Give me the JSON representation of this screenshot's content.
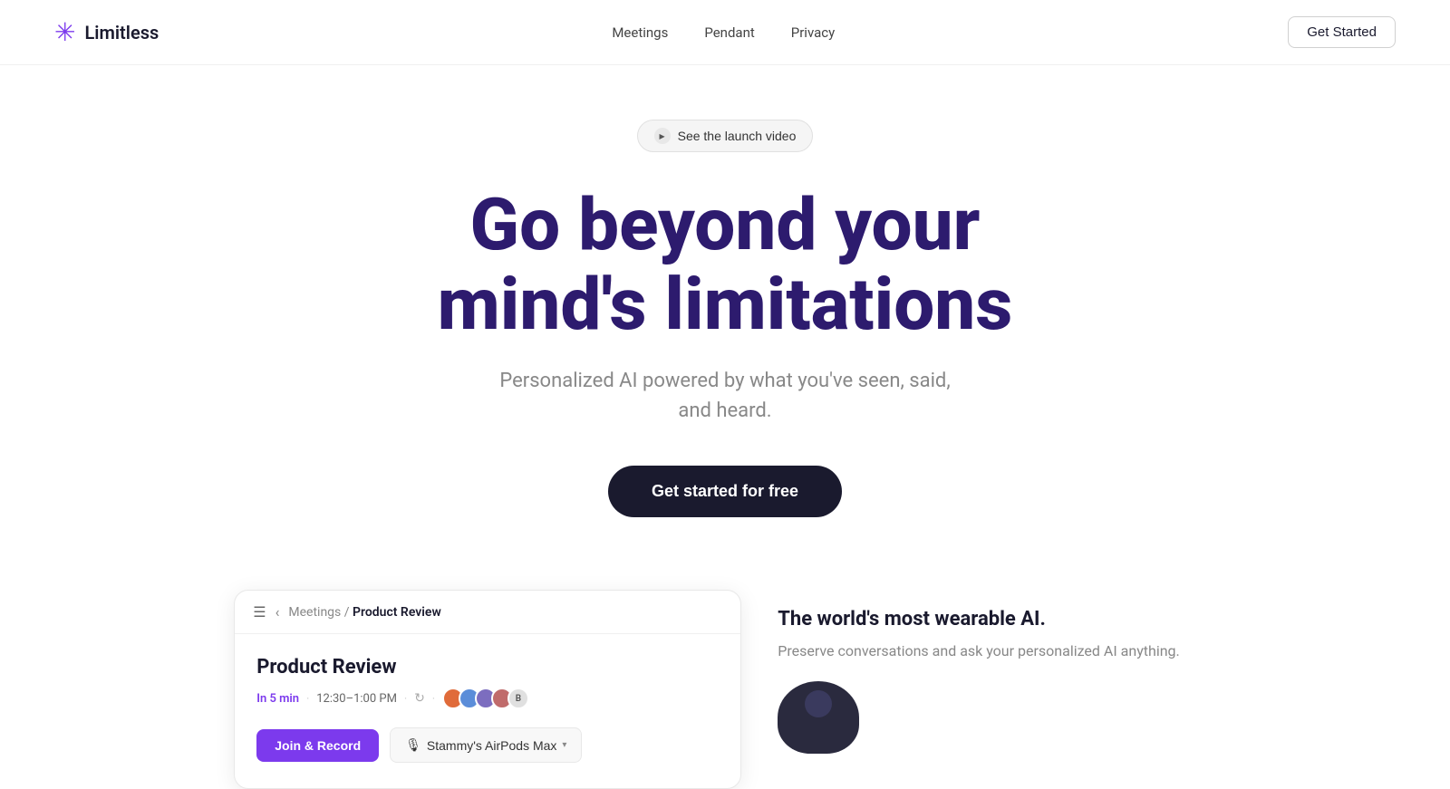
{
  "nav": {
    "logo_text": "Limitless",
    "links": [
      {
        "label": "Meetings",
        "id": "meetings"
      },
      {
        "label": "Pendant",
        "id": "pendant"
      },
      {
        "label": "Privacy",
        "id": "privacy"
      }
    ],
    "cta_label": "Get Started"
  },
  "hero": {
    "launch_video_label": "See the launch video",
    "title_line1": "Go beyond your",
    "title_line2": "mind's limitations",
    "subtitle": "Personalized AI powered by what you've seen, said, and heard.",
    "cta_label": "Get started for free"
  },
  "app_preview": {
    "topbar": {
      "breadcrumb_parent": "Meetings",
      "separator": "/",
      "breadcrumb_current": "Product Review"
    },
    "meeting": {
      "title": "Product Review",
      "time_in": "In 5 min",
      "dot1": "·",
      "time_range": "12:30–1:00 PM",
      "dot2": "·",
      "avatars": [
        {
          "color": "#e06b3a",
          "initial": ""
        },
        {
          "color": "#5b8dd9",
          "initial": ""
        },
        {
          "color": "#7c6dbf",
          "initial": ""
        },
        {
          "color": "#c06b6b",
          "initial": ""
        }
      ],
      "avatar_count": "B",
      "join_record_label": "Join & Record",
      "mic_label": "Stammy's AirPods Max"
    }
  },
  "right_panel": {
    "title": "The world's most wearable AI.",
    "description": "Preserve conversations and ask your personalized AI anything."
  },
  "colors": {
    "purple": "#7c3aed",
    "dark": "#2d1b6e",
    "text_muted": "#888888"
  }
}
